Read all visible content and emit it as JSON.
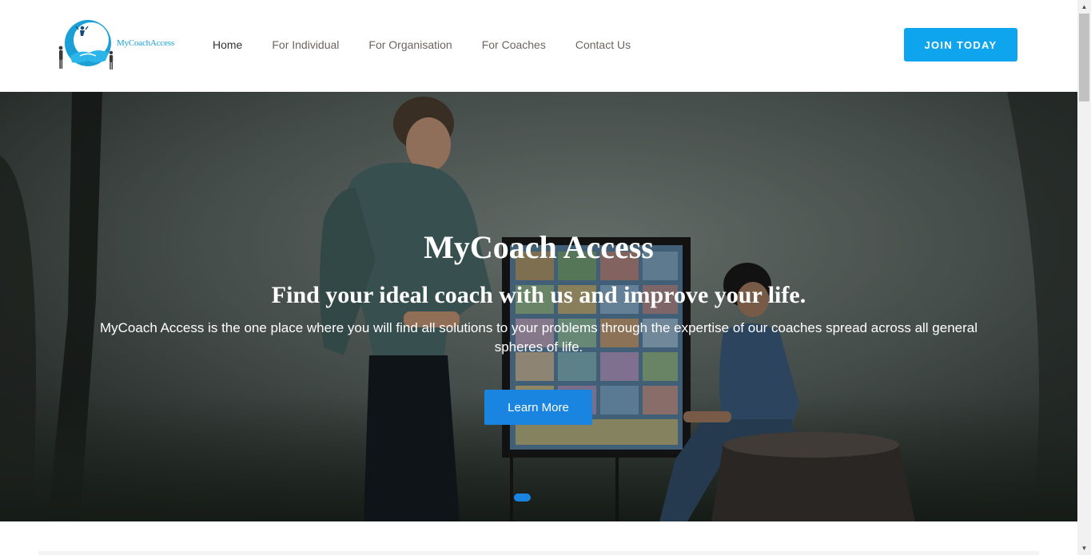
{
  "header": {
    "logo_text": "MyCoachAccess",
    "nav": [
      {
        "label": "Home",
        "active": true
      },
      {
        "label": "For Individual",
        "active": false
      },
      {
        "label": "For Organisation",
        "active": false
      },
      {
        "label": "For Coaches",
        "active": false
      },
      {
        "label": "Contact Us",
        "active": false
      }
    ],
    "join_label": "JOIN TODAY"
  },
  "hero": {
    "title": "MyCoach Access",
    "subtitle": "Find your ideal coach with us and improve your life.",
    "description": "MyCoach Access is the one place where you will find all solutions to your problems through the expertise of our coaches spread across all general spheres of life.",
    "button_label": "Learn More",
    "slide_count": 1,
    "active_slide": 1
  },
  "colors": {
    "accent": "#0ea5ee",
    "button": "#1985e0",
    "nav_text": "#6e6461",
    "nav_active": "#333333",
    "logo": "#1aa0d6"
  },
  "icons": {
    "logo": "handshake-logo-icon",
    "scroll_up": "arrow-up-icon",
    "scroll_down": "arrow-down-icon"
  }
}
